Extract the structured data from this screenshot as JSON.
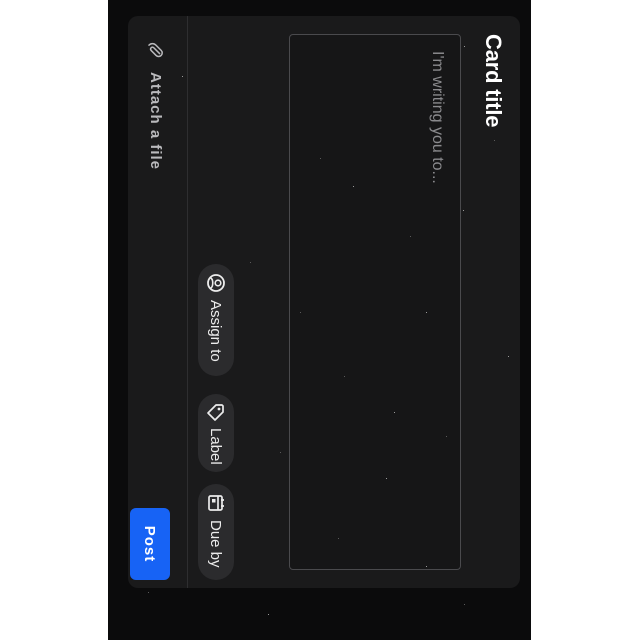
{
  "card": {
    "title": "Card title",
    "message_placeholder": "I'm writing you to...",
    "message_value": ""
  },
  "chips": {
    "assign_label": "Assign to",
    "assign_icon": "person-circle-icon",
    "label_label": "Label",
    "label_icon": "tag-icon",
    "due_label": "Due by",
    "due_icon": "calendar-icon"
  },
  "footer": {
    "attach_label": "Attach a file",
    "attach_icon": "paperclip-icon",
    "post_label": "Post"
  },
  "colors": {
    "background": "#0b0b0c",
    "card": "#1a1a1b",
    "chip": "#2b2b2d",
    "accent": "#1763f5",
    "page_margin": "#ffffff"
  }
}
